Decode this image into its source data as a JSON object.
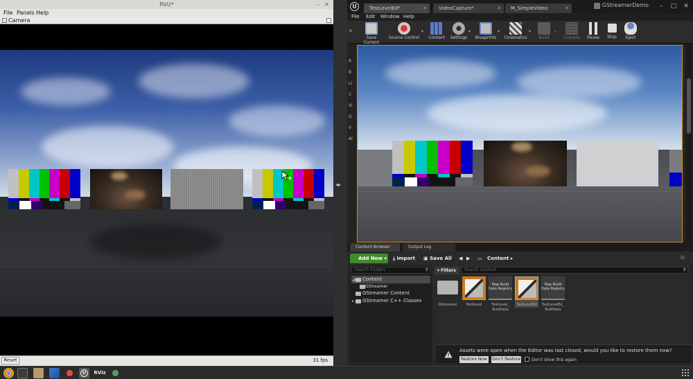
{
  "rviz": {
    "title": "RViz*",
    "menu": [
      "File",
      "Panels",
      "Help"
    ],
    "panel_title": "Camera",
    "reset_label": "Reset",
    "fps": "31 fps"
  },
  "unreal": {
    "tabs": [
      {
        "label": "TestLevelEd*"
      },
      {
        "label": "VideoCapture*"
      },
      {
        "label": "M_SimpleVideo"
      }
    ],
    "project_name": "GStreamerDemo",
    "menu": [
      "File",
      "Edit",
      "Window",
      "Help"
    ],
    "toolbar": [
      {
        "label": "Save Current",
        "icon": "save-icon",
        "enabled": true
      },
      {
        "label": "Source Control",
        "icon": "source-control-icon",
        "enabled": true
      },
      {
        "label": "Content",
        "icon": "content-icon",
        "enabled": true
      },
      {
        "label": "Settings",
        "icon": "settings-icon",
        "enabled": true
      },
      {
        "label": "Blueprints",
        "icon": "blueprints-icon",
        "enabled": true
      },
      {
        "label": "Cinematics",
        "icon": "cinematics-icon",
        "enabled": true
      },
      {
        "label": "Build",
        "icon": "build-icon",
        "enabled": false
      },
      {
        "label": "Compile",
        "icon": "compile-icon",
        "enabled": false
      },
      {
        "label": "Pause",
        "icon": "pause-icon",
        "enabled": true
      },
      {
        "label": "Stop",
        "icon": "stop-icon",
        "enabled": true
      },
      {
        "label": "Eject",
        "icon": "eject-icon",
        "enabled": true
      }
    ],
    "side_labels": [
      "R",
      "B",
      "Li",
      "C",
      "Vi",
      "G",
      "V",
      "Al"
    ],
    "content_browser": {
      "tabs": [
        "Content Browser",
        "Output Log"
      ],
      "add_new": "Add New",
      "import": "Import",
      "save_all": "Save All",
      "path": "Content",
      "folder_search_placeholder": "Search Folders",
      "asset_search_placeholder": "Search Content",
      "filters_label": "Filters",
      "tree": [
        {
          "label": "Content",
          "level": 0,
          "selected": true
        },
        {
          "label": "GStreamer",
          "level": 1,
          "selected": false
        },
        {
          "label": "GStreamer Content",
          "level": 0,
          "selected": false
        },
        {
          "label": "GStreamer C++ Classes",
          "level": 0,
          "selected": false
        }
      ],
      "assets": [
        {
          "name": "GStreamer",
          "thumb_text": "",
          "kind": "folder"
        },
        {
          "name": "TestLevel",
          "thumb_text": "",
          "kind": "level"
        },
        {
          "name": "TestLevel_ BuiltData",
          "thumb_text": "Map Build Data Registry",
          "kind": "data"
        },
        {
          "name": "TestLevelEd",
          "thumb_text": "",
          "kind": "level-selected"
        },
        {
          "name": "TestLevelEd_ BuiltData",
          "thumb_text": "Map Build Data Registry",
          "kind": "data"
        }
      ],
      "restore_message": "Assets were open when the Editor was last closed, would you like to restore them now?",
      "restore_now": "Restore Now",
      "dont_restore": "Don't Restore",
      "dont_show_again": "Don't show this again"
    }
  },
  "taskbar": {
    "apps": [
      "chrome-icon",
      "terminal-icon",
      "files-icon",
      "vscode-icon",
      "git-icon",
      "unreal-icon",
      "rviz-icon",
      "app-icon"
    ],
    "rviz_label": "RViz"
  }
}
